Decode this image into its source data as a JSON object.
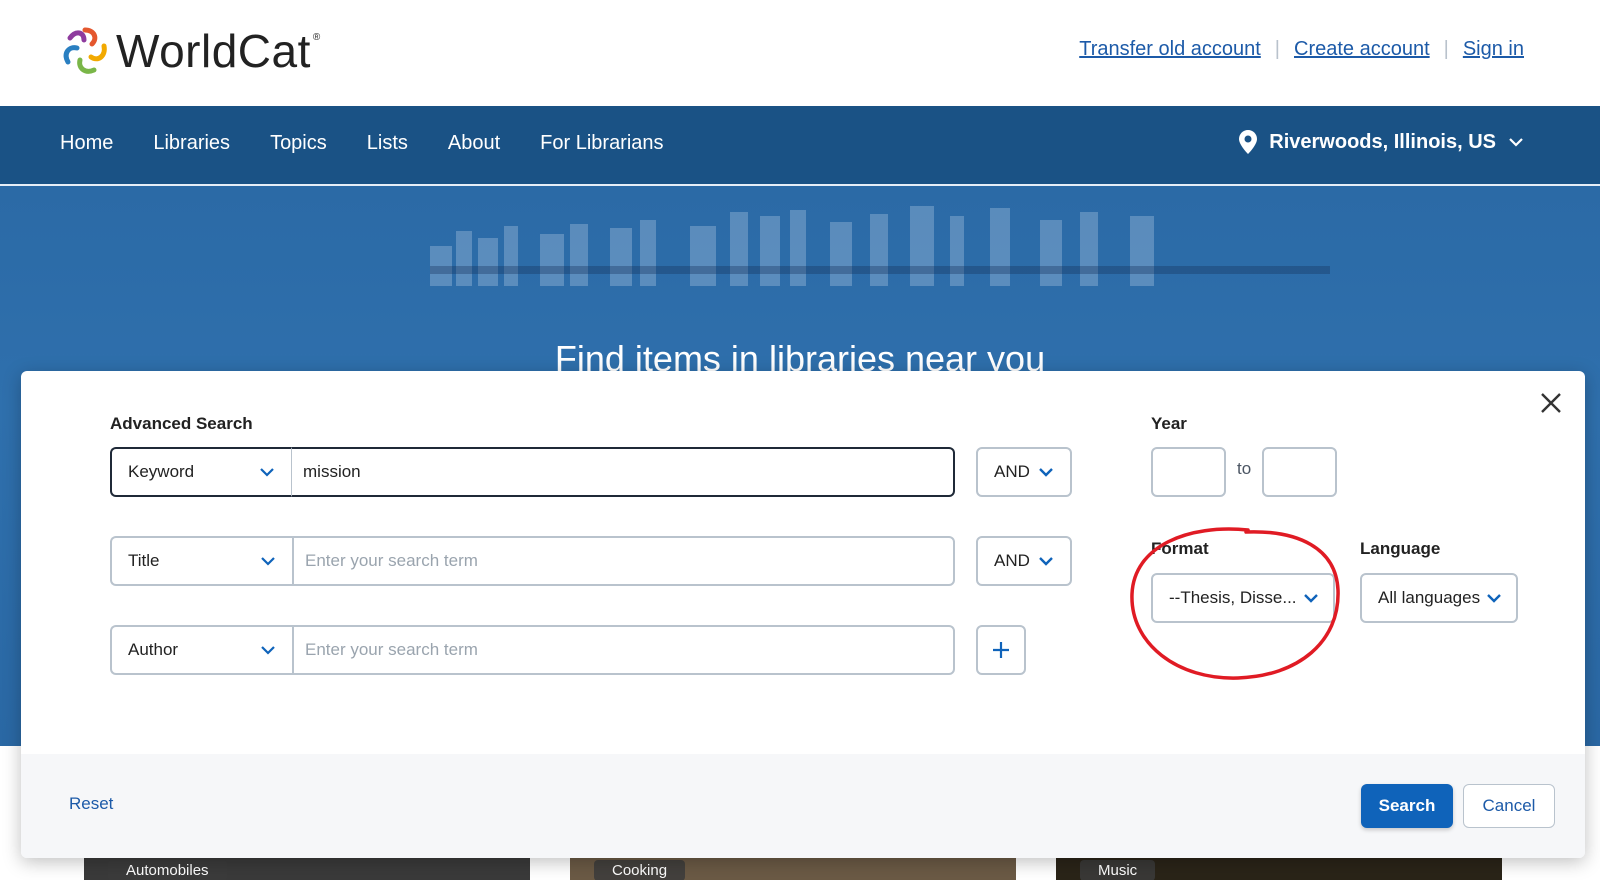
{
  "header": {
    "logo_text": "WorldCat",
    "logo_reg": "®",
    "links": [
      "Transfer old account",
      "Create account",
      "Sign in"
    ]
  },
  "nav": {
    "items": [
      "Home",
      "Libraries",
      "Topics",
      "Lists",
      "About",
      "For Librarians"
    ],
    "location": "Riverwoods, Illinois, US"
  },
  "hero": {
    "title": "Find items in libraries near you"
  },
  "tiles": [
    "Automobiles",
    "Cooking",
    "Music"
  ],
  "advanced_search": {
    "label": "Advanced Search",
    "rows": [
      {
        "field": "Keyword",
        "value": "mission",
        "placeholder": "Enter your search term",
        "operator": "AND"
      },
      {
        "field": "Title",
        "value": "",
        "placeholder": "Enter your search term",
        "operator": "AND"
      },
      {
        "field": "Author",
        "value": "",
        "placeholder": "Enter your search term"
      }
    ],
    "year_label": "Year",
    "year_to": "to",
    "format_label": "Format",
    "format_value": "--Thesis, Disse...",
    "language_label": "Language",
    "language_value": "All languages",
    "reset_label": "Reset",
    "search_label": "Search",
    "cancel_label": "Cancel"
  },
  "colors": {
    "nav_bg": "#1a5285",
    "primary": "#0f63ba",
    "link": "#1c5aa8",
    "annotation": "#e01b24"
  }
}
